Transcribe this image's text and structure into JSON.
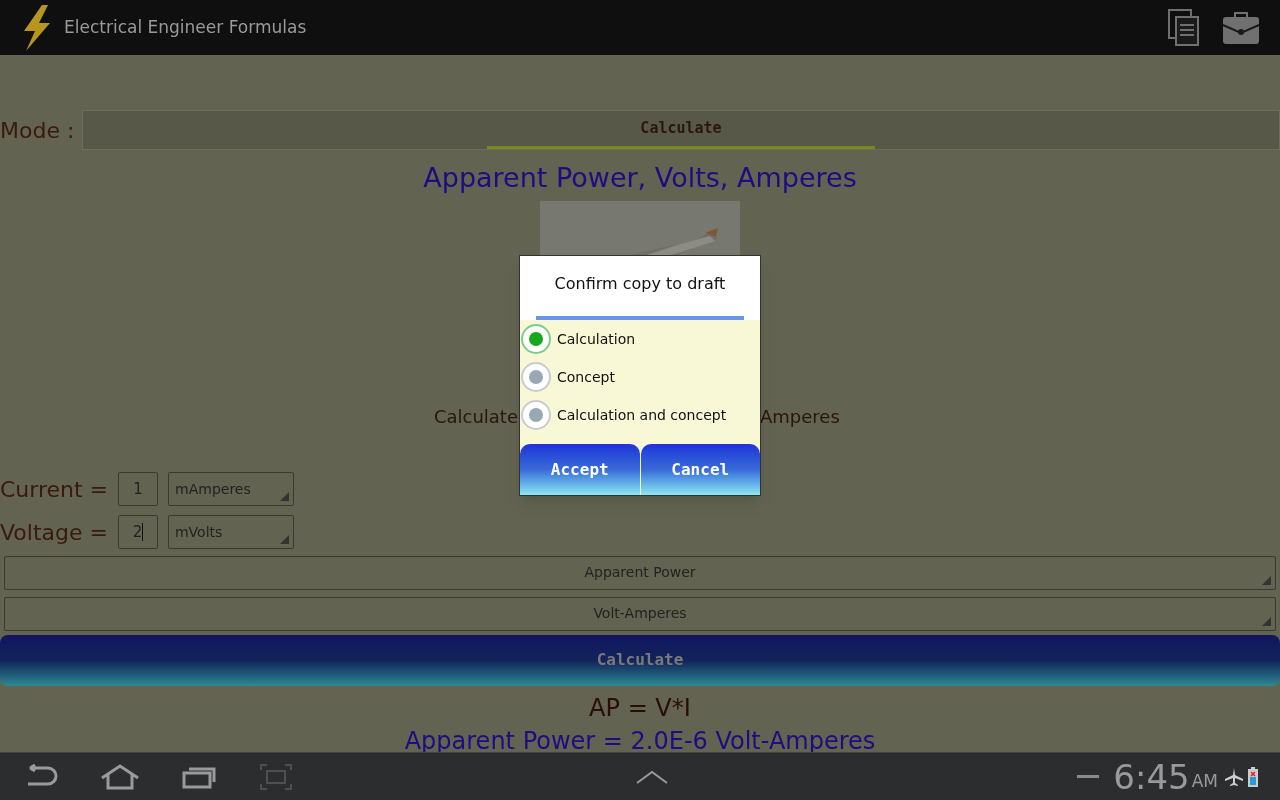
{
  "action_bar": {
    "title": "Electrical Engineer Formulas"
  },
  "mode": {
    "label": "Mode :",
    "tab": "Calculate"
  },
  "heading": "Apparent Power, Volts, Amperes",
  "picture": {
    "kind": "picture"
  },
  "calculate_line": {
    "left": "Calculate",
    "right": "Amperes"
  },
  "inputs": [
    {
      "label": "Current =",
      "value": "1",
      "unit": "mAmperes",
      "focused": false
    },
    {
      "label": "Voltage =",
      "value": "2",
      "unit": "mVolts",
      "focused": true
    }
  ],
  "selectors": [
    "Apparent Power",
    "Volt-Amperes"
  ],
  "calculate_button": "Calculate",
  "formula": "AP = V*I",
  "result": "Apparent Power = 2.0E-6 Volt-Amperes",
  "dialog": {
    "title": "Confirm copy to draft",
    "options": [
      {
        "label": "Calculation",
        "selected": true
      },
      {
        "label": "Concept",
        "selected": false
      },
      {
        "label": "Calculation and concept",
        "selected": false
      }
    ],
    "buttons": [
      "Accept",
      "Cancel"
    ]
  },
  "status_bar": {
    "time": "6:45",
    "ampm": "AM"
  }
}
